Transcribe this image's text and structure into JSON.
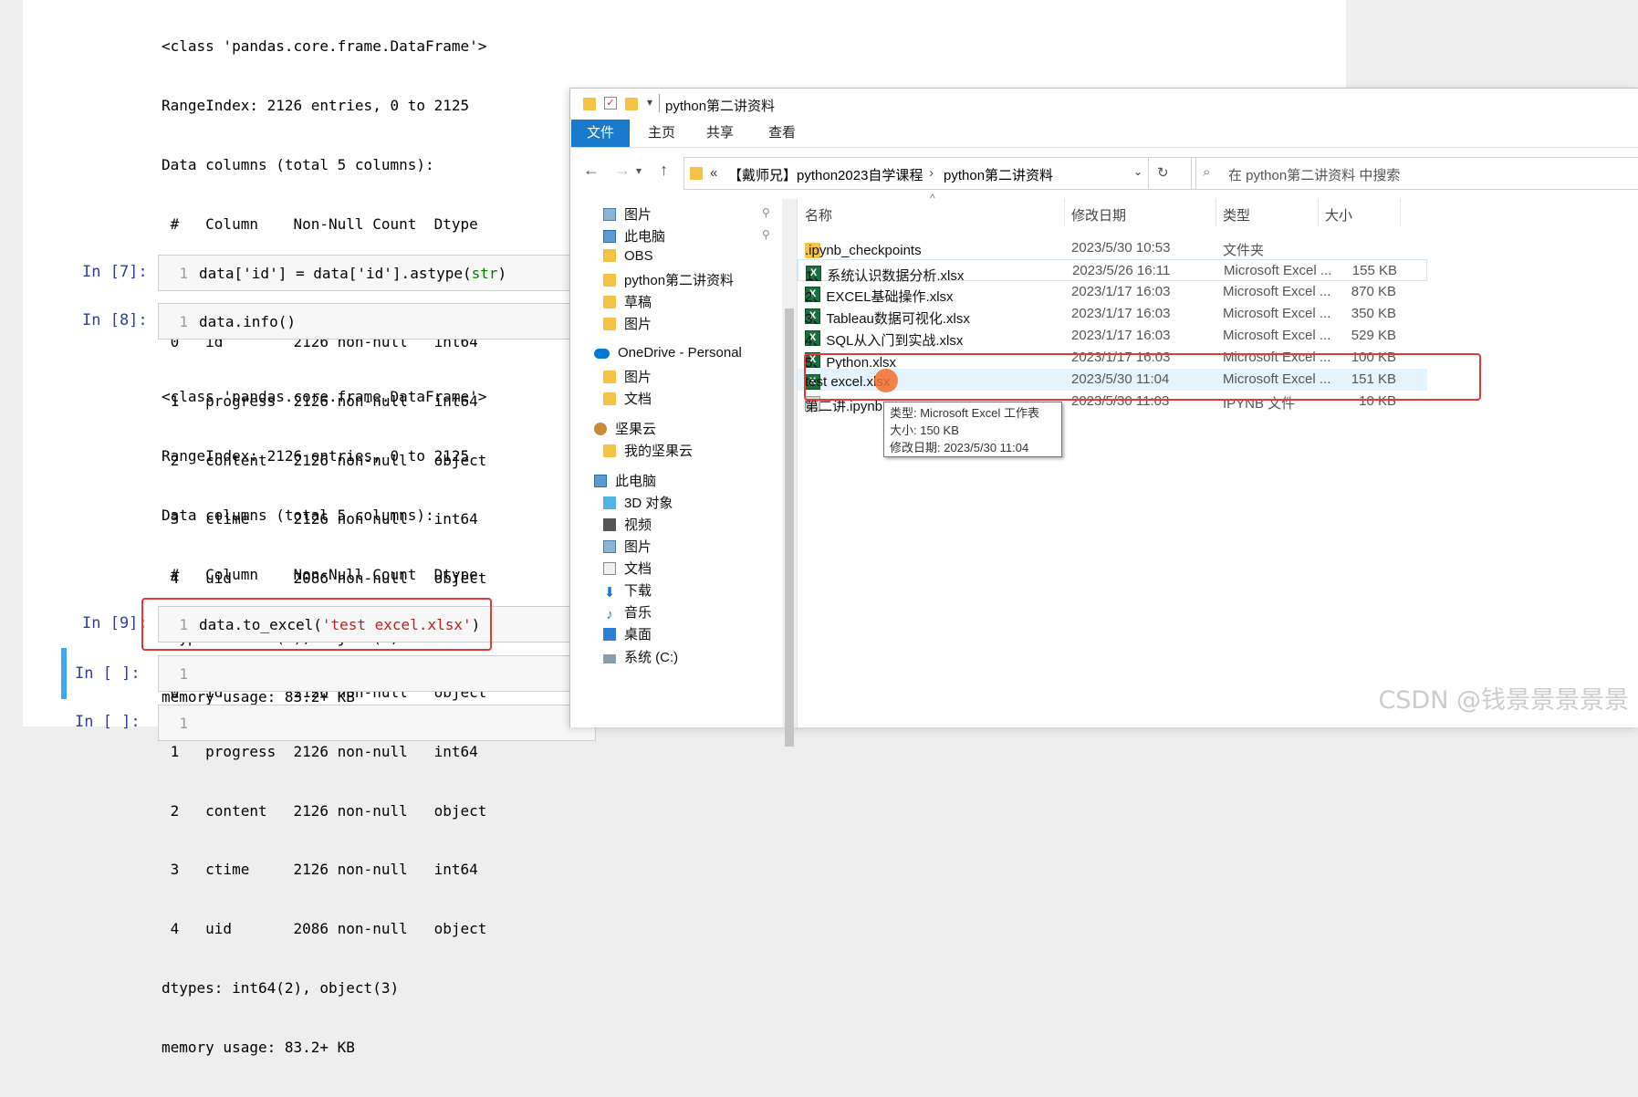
{
  "notebook": {
    "out1": [
      "<class 'pandas.core.frame.DataFrame'>",
      "RangeIndex: 2126 entries, 0 to 2125",
      "Data columns (total 5 columns):",
      " #   Column    Non-Null Count  Dtype ",
      "---  ------    --------------  ----- ",
      " 0   id        2126 non-null   int64 ",
      " 1   progress  2126 non-null   int64 ",
      " 2   content   2126 non-null   object",
      " 3   ctime     2126 non-null   int64 ",
      " 4   uid       2086 non-null   object",
      "dtypes: int64(3), object(2)",
      "memory usage: 83.2+ KB"
    ],
    "cells": [
      {
        "prompt": "In [7]:",
        "line": "1",
        "code_a": "data['id'] = data['id'].astype(",
        "code_kw": "str",
        "code_b": ")"
      },
      {
        "prompt": "In [8]:",
        "line": "1",
        "code": "data.info()"
      },
      {
        "prompt": "In [9]:",
        "line": "1",
        "code_a": "data.to_excel(",
        "code_str": "'test excel.xlsx'",
        "code_b": ")"
      },
      {
        "prompt": "In [ ]:",
        "line": "1"
      },
      {
        "prompt": "In [ ]:",
        "line": "1"
      }
    ],
    "out2": [
      "<class 'pandas.core.frame.DataFrame'>",
      "RangeIndex: 2126 entries, 0 to 2125",
      "Data columns (total 5 columns):",
      " #   Column    Non-Null Count  Dtype ",
      "---  ------    --------------  ----- ",
      " 0   id        2126 non-null   object",
      " 1   progress  2126 non-null   int64 ",
      " 2   content   2126 non-null   object",
      " 3   ctime     2126 non-null   int64 ",
      " 4   uid       2086 non-null   object",
      "dtypes: int64(2), object(3)",
      "memory usage: 83.2+ KB"
    ]
  },
  "explorer": {
    "title": "python第二讲资料",
    "ribbon": [
      "文件",
      "主页",
      "共享",
      "查看"
    ],
    "path_prefix": "«",
    "path": [
      "【戴师兄】python2023自学课程",
      "python第二讲资料"
    ],
    "search_placeholder": "在 python第二讲资料 中搜索",
    "sidebar": [
      {
        "label": "图片",
        "icon": "pictures-icon",
        "pinned": true
      },
      {
        "label": "此电脑",
        "icon": "pc-icon",
        "pinned": true
      },
      {
        "label": "OBS",
        "icon": "folder-icon"
      },
      {
        "label": "python第二讲资料",
        "icon": "folder-icon"
      },
      {
        "label": "草稿",
        "icon": "folder-icon"
      },
      {
        "label": "图片",
        "icon": "folder-icon"
      },
      {
        "label": "OneDrive - Personal",
        "icon": "onedrive-icon"
      },
      {
        "label": "图片",
        "icon": "folder-icon"
      },
      {
        "label": "文档",
        "icon": "folder-icon"
      },
      {
        "label": "坚果云",
        "icon": "nutstore-icon"
      },
      {
        "label": "我的坚果云",
        "icon": "folder-icon"
      },
      {
        "label": "此电脑",
        "icon": "pc-icon"
      },
      {
        "label": "3D 对象",
        "icon": "3d-objects-icon"
      },
      {
        "label": "视频",
        "icon": "video-icon"
      },
      {
        "label": "图片",
        "icon": "pictures-icon"
      },
      {
        "label": "文档",
        "icon": "documents-icon"
      },
      {
        "label": "下载",
        "icon": "download-icon"
      },
      {
        "label": "音乐",
        "icon": "music-icon"
      },
      {
        "label": "桌面",
        "icon": "desktop-icon"
      },
      {
        "label": "系统 (C:)",
        "icon": "drive-icon"
      }
    ],
    "columns": [
      "名称",
      "修改日期",
      "类型",
      "大小"
    ],
    "files": [
      {
        "name": ".ipynb_checkpoints",
        "date": "2023/5/30 10:53",
        "type": "文件夹",
        "size": "",
        "icon": "folder-icon"
      },
      {
        "name": "1、系统认识数据分析.xlsx",
        "date": "2023/5/26 16:11",
        "type": "Microsoft Excel ...",
        "size": "155 KB",
        "icon": "excel-icon"
      },
      {
        "name": "2、EXCEL基础操作.xlsx",
        "date": "2023/1/17 16:03",
        "type": "Microsoft Excel ...",
        "size": "870 KB",
        "icon": "excel-icon"
      },
      {
        "name": "3、Tableau数据可视化.xlsx",
        "date": "2023/1/17 16:03",
        "type": "Microsoft Excel ...",
        "size": "350 KB",
        "icon": "excel-icon"
      },
      {
        "name": "4、SQL从入门到实战.xlsx",
        "date": "2023/1/17 16:03",
        "type": "Microsoft Excel ...",
        "size": "529 KB",
        "icon": "excel-icon"
      },
      {
        "name": "5、Python.xlsx",
        "date": "2023/1/17 16:03",
        "type": "Microsoft Excel ...",
        "size": "100 KB",
        "icon": "excel-icon"
      },
      {
        "name": "test excel.xlsx",
        "date": "2023/5/30 11:04",
        "type": "Microsoft Excel ...",
        "size": "151 KB",
        "icon": "excel-icon"
      },
      {
        "name": "第二讲.ipynb",
        "date": "2023/5/30 11:03",
        "type": "IPYNB 文件",
        "size": "10 KB",
        "icon": "notebook-icon"
      }
    ],
    "tooltip": [
      "类型: Microsoft Excel 工作表",
      "大小: 150 KB",
      "修改日期: 2023/5/30 11:04"
    ]
  },
  "watermark": "CSDN @钱景景景景景"
}
